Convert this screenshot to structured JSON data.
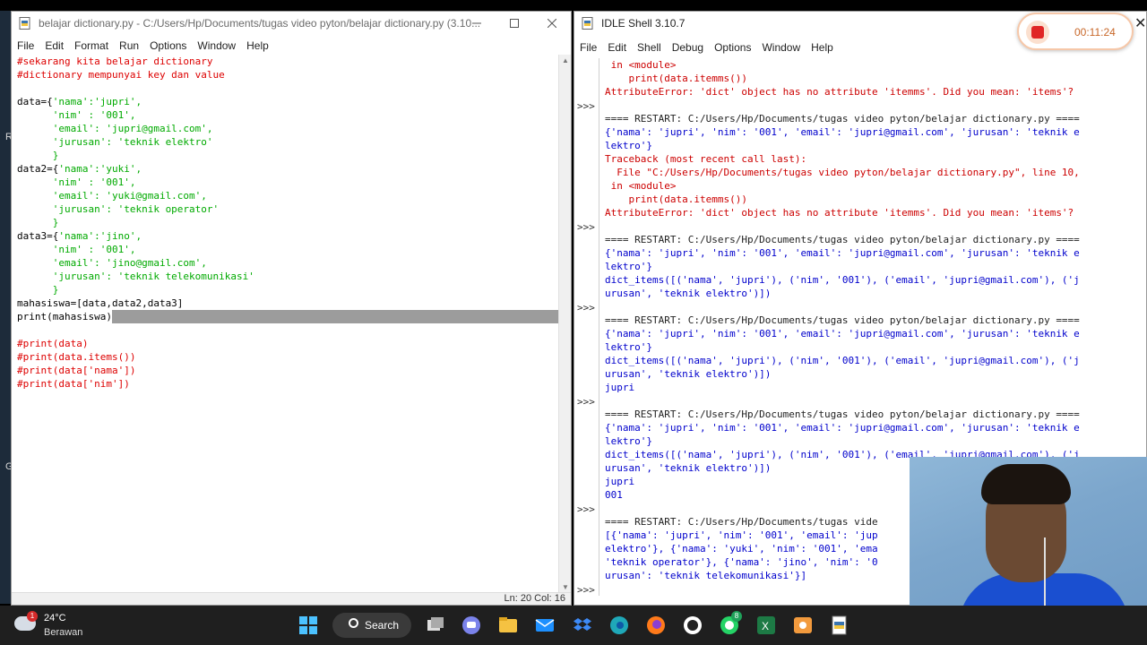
{
  "editor": {
    "title": "belajar dictionary.py - C:/Users/Hp/Documents/tugas video pyton/belajar dictionary.py (3.10...",
    "menu": [
      "File",
      "Edit",
      "Format",
      "Run",
      "Options",
      "Window",
      "Help"
    ],
    "code_lines": [
      {
        "t": "#sekarang kita belajar dictionary",
        "c": "com"
      },
      {
        "t": "#dictionary mempunyai key dan value",
        "c": "com"
      },
      {
        "t": "",
        "c": "def"
      },
      {
        "t": "data={'nama':'jupri',",
        "c": "mix"
      },
      {
        "t": "      'nim' : '001',",
        "c": "str"
      },
      {
        "t": "      'email': 'jupri@gmail.com',",
        "c": "str"
      },
      {
        "t": "      'jurusan': 'teknik elektro'",
        "c": "str"
      },
      {
        "t": "      }",
        "c": "str"
      },
      {
        "t": "data2={'nama':'yuki',",
        "c": "mix"
      },
      {
        "t": "      'nim' : '001',",
        "c": "str"
      },
      {
        "t": "      'email': 'yuki@gmail.com',",
        "c": "str"
      },
      {
        "t": "      'jurusan': 'teknik operator'",
        "c": "str"
      },
      {
        "t": "      }",
        "c": "str"
      },
      {
        "t": "data3={'nama':'jino',",
        "c": "mix"
      },
      {
        "t": "      'nim' : '001',",
        "c": "str"
      },
      {
        "t": "      'email': 'jino@gmail.com',",
        "c": "str"
      },
      {
        "t": "      'jurusan': 'teknik telekomunikasi'",
        "c": "str"
      },
      {
        "t": "      }",
        "c": "str"
      },
      {
        "t": "mahasiswa=[data,data2,data3]",
        "c": "def"
      },
      {
        "t": "print(mahasiswa)",
        "c": "def"
      },
      {
        "t": "",
        "c": "def"
      },
      {
        "t": "#print(data)",
        "c": "com"
      },
      {
        "t": "#print(data.items())",
        "c": "com"
      },
      {
        "t": "#print(data['nama'])",
        "c": "com"
      },
      {
        "t": "#print(data['nim'])",
        "c": "com"
      }
    ],
    "status": "Ln: 20   Col: 16"
  },
  "shell": {
    "title": "IDLE Shell 3.10.7",
    "menu": [
      "File",
      "Edit",
      "Shell",
      "Debug",
      "Options",
      "Window",
      "Help"
    ],
    "prompt": ">>>",
    "lines": [
      {
        "t": " in <module>",
        "c": "err"
      },
      {
        "t": "    print(data.itemms())",
        "c": "err"
      },
      {
        "t": "AttributeError: 'dict' object has no attribute 'itemms'. Did you mean: 'items'?",
        "c": "err"
      },
      {
        "t": "",
        "c": "res",
        "p": true
      },
      {
        "t": "==== RESTART: C:/Users/Hp/Documents/tugas video pyton/belajar dictionary.py ====",
        "c": "res"
      },
      {
        "t": "{'nama': 'jupri', 'nim': '001', 'email': 'jupri@gmail.com', 'jurusan': 'teknik e",
        "c": "std"
      },
      {
        "t": "lektro'}",
        "c": "std"
      },
      {
        "t": "Traceback (most recent call last):",
        "c": "err"
      },
      {
        "t": "  File \"C:/Users/Hp/Documents/tugas video pyton/belajar dictionary.py\", line 10,",
        "c": "err"
      },
      {
        "t": " in <module>",
        "c": "err"
      },
      {
        "t": "    print(data.itemms())",
        "c": "err"
      },
      {
        "t": "AttributeError: 'dict' object has no attribute 'itemms'. Did you mean: 'items'?",
        "c": "err"
      },
      {
        "t": "",
        "c": "res",
        "p": true
      },
      {
        "t": "==== RESTART: C:/Users/Hp/Documents/tugas video pyton/belajar dictionary.py ====",
        "c": "res"
      },
      {
        "t": "{'nama': 'jupri', 'nim': '001', 'email': 'jupri@gmail.com', 'jurusan': 'teknik e",
        "c": "std"
      },
      {
        "t": "lektro'}",
        "c": "std"
      },
      {
        "t": "dict_items([('nama', 'jupri'), ('nim', '001'), ('email', 'jupri@gmail.com'), ('j",
        "c": "std"
      },
      {
        "t": "urusan', 'teknik elektro')])",
        "c": "std"
      },
      {
        "t": "",
        "c": "res",
        "p": true
      },
      {
        "t": "==== RESTART: C:/Users/Hp/Documents/tugas video pyton/belajar dictionary.py ====",
        "c": "res"
      },
      {
        "t": "{'nama': 'jupri', 'nim': '001', 'email': 'jupri@gmail.com', 'jurusan': 'teknik e",
        "c": "std"
      },
      {
        "t": "lektro'}",
        "c": "std"
      },
      {
        "t": "dict_items([('nama', 'jupri'), ('nim', '001'), ('email', 'jupri@gmail.com'), ('j",
        "c": "std"
      },
      {
        "t": "urusan', 'teknik elektro')])",
        "c": "std"
      },
      {
        "t": "jupri",
        "c": "std"
      },
      {
        "t": "",
        "c": "res",
        "p": true
      },
      {
        "t": "==== RESTART: C:/Users/Hp/Documents/tugas video pyton/belajar dictionary.py ====",
        "c": "res"
      },
      {
        "t": "{'nama': 'jupri', 'nim': '001', 'email': 'jupri@gmail.com', 'jurusan': 'teknik e",
        "c": "std"
      },
      {
        "t": "lektro'}",
        "c": "std"
      },
      {
        "t": "dict_items([('nama', 'jupri'), ('nim', '001'), ('email', 'jupri@gmail.com'), ('j",
        "c": "std"
      },
      {
        "t": "urusan', 'teknik elektro')])",
        "c": "std"
      },
      {
        "t": "jupri",
        "c": "std"
      },
      {
        "t": "001",
        "c": "std"
      },
      {
        "t": "",
        "c": "res",
        "p": true
      },
      {
        "t": "==== RESTART: C:/Users/Hp/Documents/tugas vide",
        "c": "res"
      },
      {
        "t": "[{'nama': 'jupri', 'nim': '001', 'email': 'jup",
        "c": "std"
      },
      {
        "t": "elektro'}, {'nama': 'yuki', 'nim': '001', 'ema",
        "c": "std"
      },
      {
        "t": "'teknik operator'}, {'nama': 'jino', 'nim': '0",
        "c": "std"
      },
      {
        "t": "urusan': 'teknik telekomunikasi'}]",
        "c": "std"
      },
      {
        "t": "",
        "c": "res",
        "p": true
      }
    ]
  },
  "recorder": {
    "time": "00:11:24"
  },
  "close_glyph": "✕",
  "desktop_letters": [
    "R",
    "G"
  ],
  "taskbar": {
    "weather_badge": "1",
    "temp": "24°C",
    "condition": "Berawan",
    "search_label": "Search",
    "whatsapp_badge": "8",
    "icons": [
      "windows-start-icon",
      "search-icon",
      "task-view-icon",
      "teams-chat-icon",
      "file-explorer-icon",
      "mail-icon",
      "dropbox-icon",
      "edge-icon",
      "firefox-icon",
      "github-icon",
      "whatsapp-icon",
      "excel-icon",
      "recorder-icon",
      "python-idle-icon"
    ]
  },
  "colors": {
    "comment": "#dd0000",
    "string": "#00aa00",
    "stdout": "#0000cc",
    "error": "#cc0000",
    "recorder_red": "#e02626",
    "shirt": "#1a4fd0"
  }
}
